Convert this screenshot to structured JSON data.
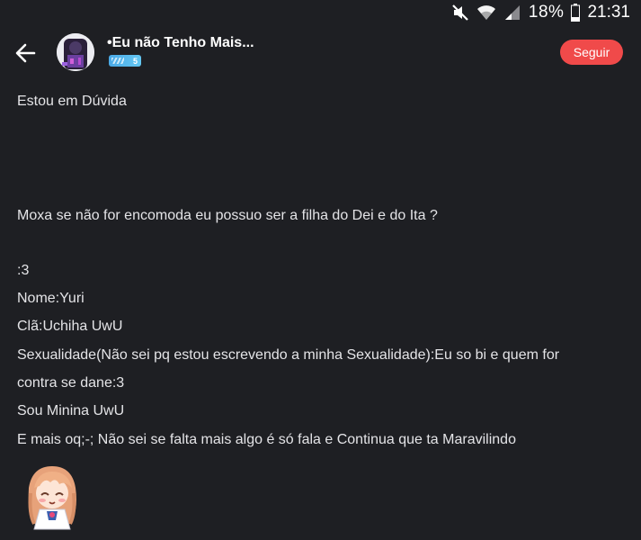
{
  "status_bar": {
    "battery_percent": "18%",
    "time": "21:31",
    "icons": [
      "mute-icon",
      "wifi-icon",
      "signal-icon",
      "battery-icon"
    ]
  },
  "header": {
    "back_icon": "arrow-left-icon",
    "title": "•Eu não Tenho Mais...",
    "level": "5",
    "follow_label": "Seguir",
    "follow_color": "#f04a4a",
    "level_color": "#4aa9e6"
  },
  "post": {
    "title": "Estou em Dúvida",
    "lines": [
      "Moxa se não for encomoda eu possuo ser a filha do Dei e do Ita ?",
      ":3",
      "Nome:Yuri",
      "Clã:Uchiha UwU",
      "Sexualidade(Não sei pq estou escrevendo a minha Sexualidade):Eu so bi e quem for",
      "contra se dane:3",
      "Sou Minina UwU",
      "E mais oq;-; Não sei se falta mais algo é só fala e Continua que ta Maravilindo"
    ]
  },
  "colors": {
    "background": "#1e1f23",
    "text": "#e4e4e7"
  }
}
